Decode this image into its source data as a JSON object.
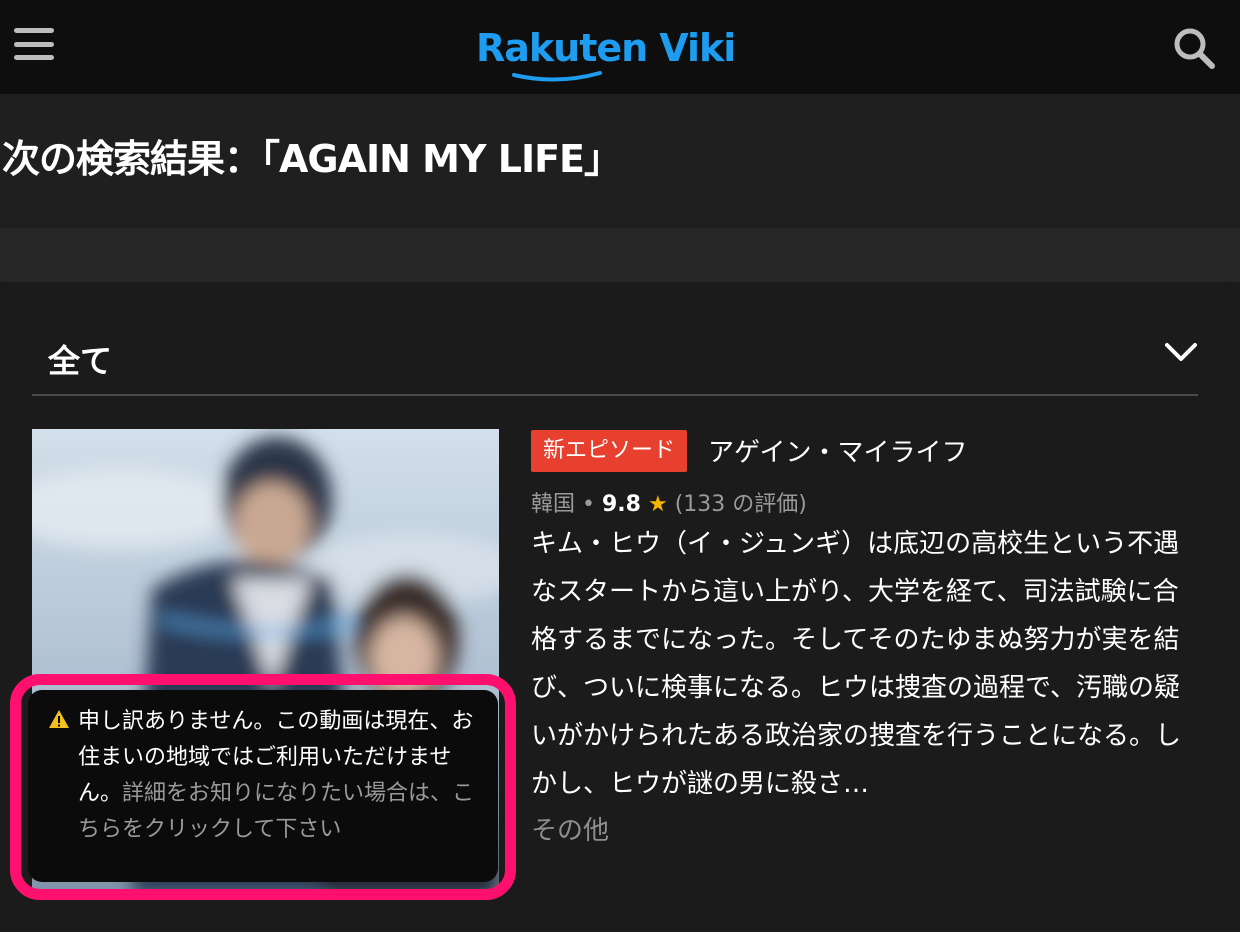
{
  "header": {
    "logo_part1": "Rakuten",
    "logo_part2": "Viki",
    "brand_color": "#1e9cf0",
    "menu_icon": "hamburger-menu-icon",
    "search_icon": "search-icon"
  },
  "search": {
    "title": "次の検索結果：「AGAIN MY LIFE」"
  },
  "filter": {
    "selected": "全て",
    "icon": "chevron-down-icon"
  },
  "result": {
    "badge": "新エピソード",
    "badge_color": "#e8402e",
    "title": "アゲイン・マイライフ",
    "country": "韓国 • ",
    "rating": "9.8",
    "star": "★",
    "reviews": "(133 の評価)",
    "description": "キム・ヒウ（イ・ジュンギ）は底辺の高校生という不遇なスタートから這い上がり、大学を経て、司法試験に合格するまでになった。そしてそのたゆまぬ努力が実を結び、ついに検事になる。ヒウは捜査の過程で、汚職の疑いがかけられたある政治家の捜査を行うことになる。しかし、ヒウが謎の男に殺さ…",
    "more_label": "その他"
  },
  "notice": {
    "icon": "warning-icon",
    "text": "申し訳ありません。この動画は現在、お住まいの地域ではご利用いただけません。",
    "link_text": "詳細をお知りになりたい場合は、こちらをクリックして下さい",
    "highlight_color": "#ff0f6e"
  }
}
